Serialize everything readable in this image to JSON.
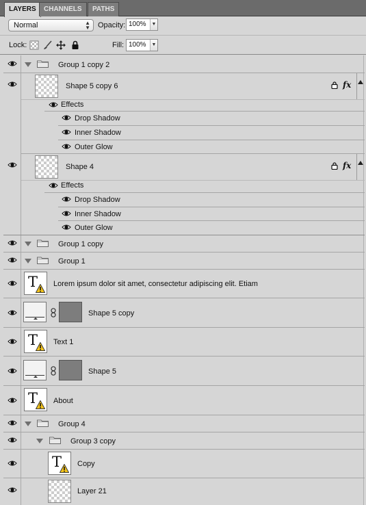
{
  "tabs": [
    "LAYERS",
    "CHANNELS",
    "PATHS"
  ],
  "blend_mode": "Normal",
  "opacity_label": "Opacity:",
  "opacity_value": "100%",
  "lock_label": "Lock:",
  "fill_label": "Fill:",
  "fill_value": "100%",
  "layers": {
    "g1c2": "Group 1 copy 2",
    "s5c6": "Shape 5 copy 6",
    "effects": "Effects",
    "drop_shadow": "Drop Shadow",
    "inner_shadow": "Inner Shadow",
    "outer_glow": "Outer Glow",
    "s4": "Shape 4",
    "g1c": "Group 1 copy",
    "g1": "Group 1",
    "lorem": "Lorem ipsum dolor sit amet, consectetur adipiscing elit. Etiam",
    "s5c": "Shape 5 copy",
    "text1": "Text 1",
    "s5": "Shape 5",
    "about": "About",
    "g4": "Group 4",
    "g3c": "Group 3 copy",
    "copy": "Copy",
    "layer21": "Layer 21"
  },
  "fx_label": "fx",
  "icons": {
    "eye": "eye-icon",
    "folder": "folder-icon",
    "lock": "lock-icon",
    "warning": "warning-icon",
    "chain": "chain-link-icon"
  }
}
